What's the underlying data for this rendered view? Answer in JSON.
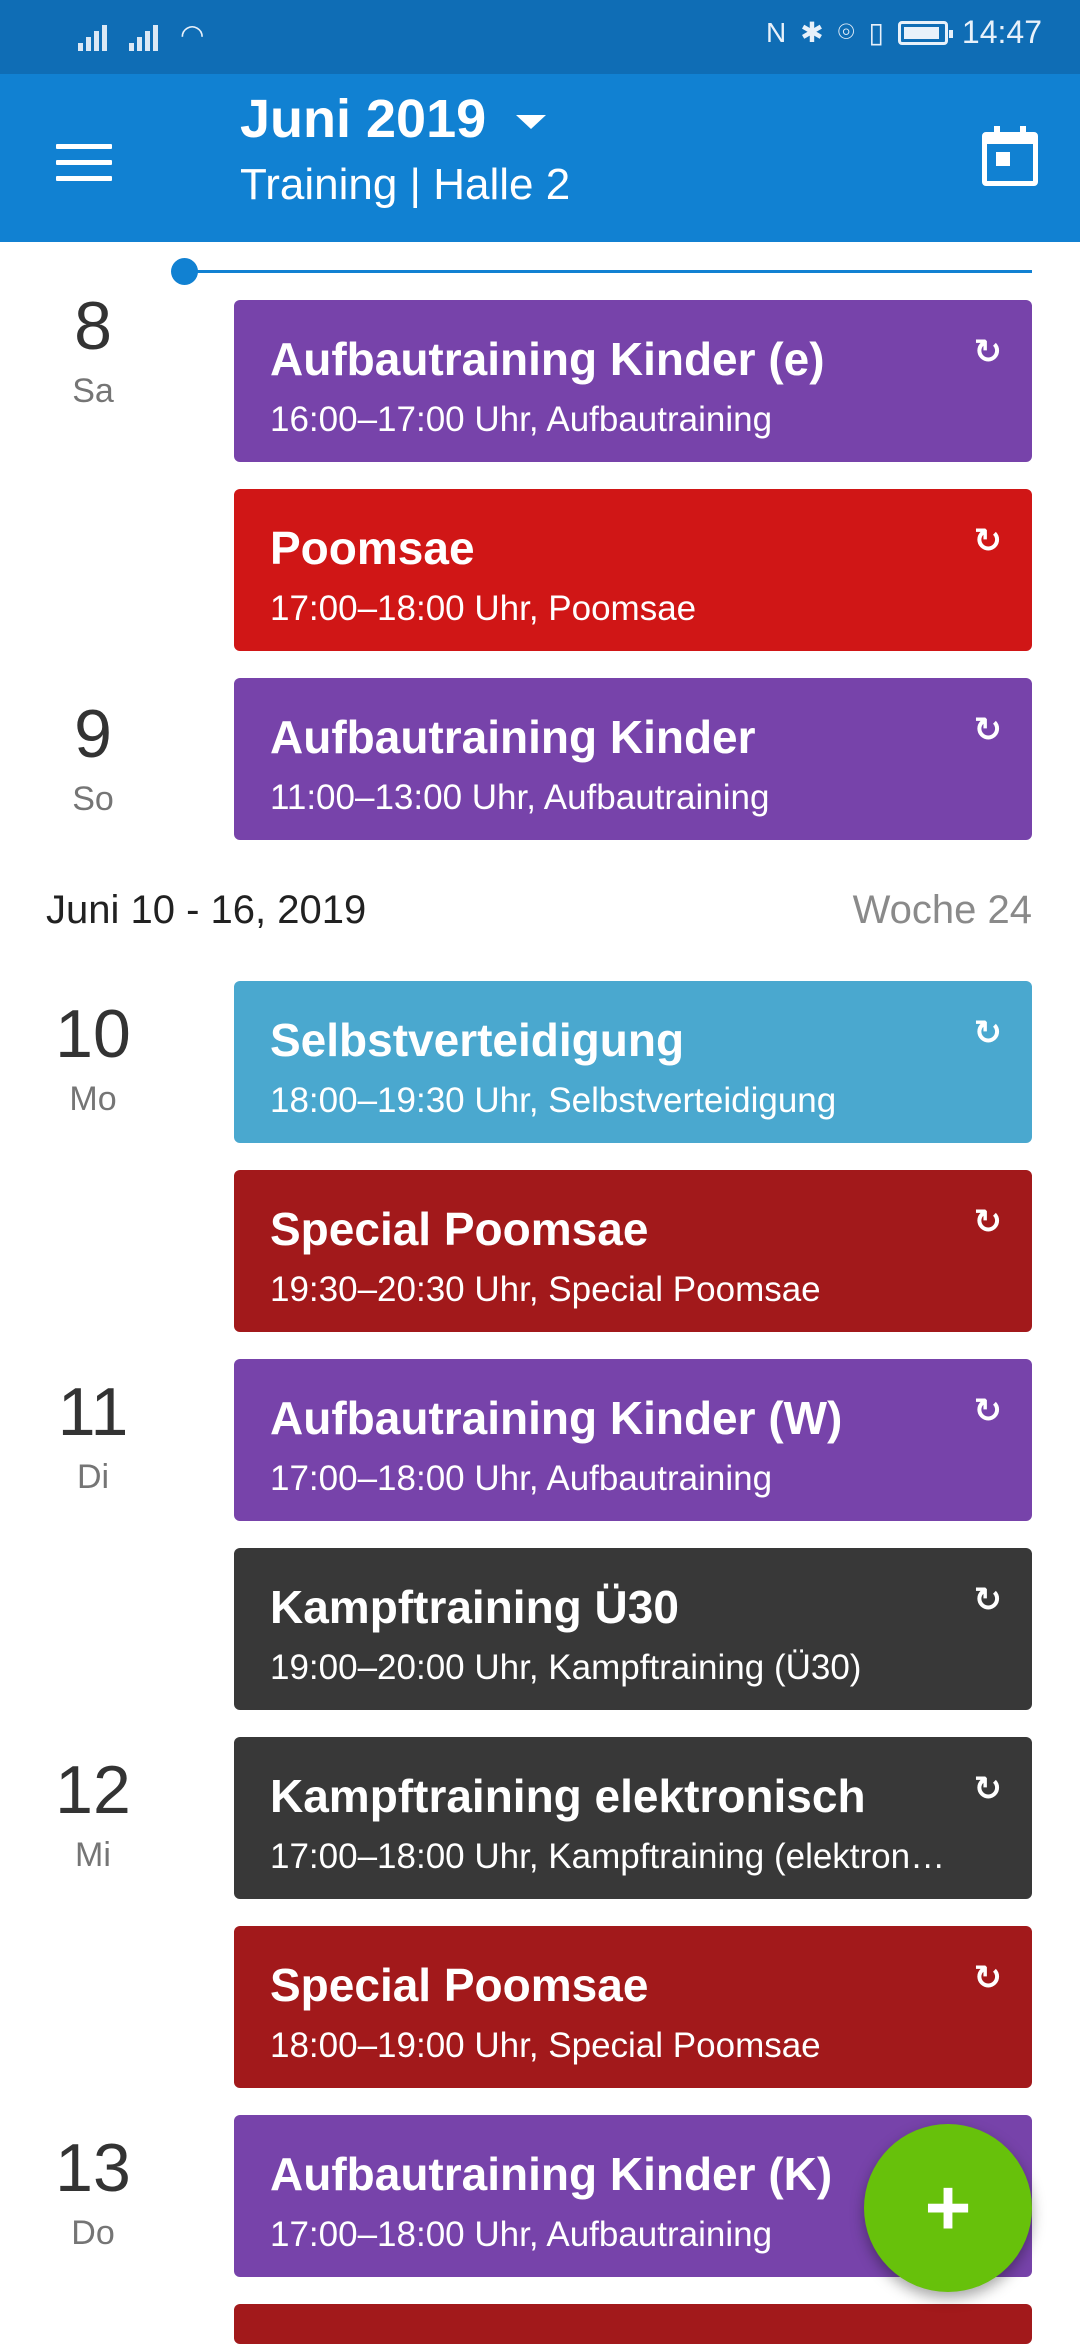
{
  "status_bar": {
    "time": "14:47",
    "icons": [
      "signal-icon",
      "signal-icon",
      "wifi-icon",
      "nfc-icon",
      "bluetooth-icon",
      "location-icon",
      "vibrate-icon",
      "battery-icon"
    ]
  },
  "app_bar": {
    "title": "Juni 2019",
    "subtitle": "Training | Halle 2"
  },
  "days": [
    {
      "num": "8",
      "weekday": "Sa"
    },
    {
      "num": "9",
      "weekday": "So"
    },
    {
      "num": "10",
      "weekday": "Mo"
    },
    {
      "num": "11",
      "weekday": "Di"
    },
    {
      "num": "12",
      "weekday": "Mi"
    },
    {
      "num": "13",
      "weekday": "Do"
    }
  ],
  "week_header": {
    "range": "Juni 10 - 16, 2019",
    "week": "Woche 24"
  },
  "events": [
    {
      "title": "Aufbautraining Kinder (e)",
      "subtitle": "16:00–17:00 Uhr, Aufbautraining",
      "color": "#7743aa"
    },
    {
      "title": "Poomsae",
      "subtitle": "17:00–18:00 Uhr, Poomsae",
      "color": "#d01616"
    },
    {
      "title": "Aufbautraining Kinder",
      "subtitle": "11:00–13:00 Uhr, Aufbautraining",
      "color": "#7743aa"
    },
    {
      "title": "Selbstverteidigung",
      "subtitle": "18:00–19:30 Uhr, Selbstverteidigung",
      "color": "#4aa8cf"
    },
    {
      "title": "Special Poomsae",
      "subtitle": "19:30–20:30 Uhr, Special Poomsae",
      "color": "#a2191b"
    },
    {
      "title": "Aufbautraining Kinder (W)",
      "subtitle": "17:00–18:00 Uhr, Aufbautraining",
      "color": "#7743aa"
    },
    {
      "title": "Kampftraining Ü30",
      "subtitle": "19:00–20:00 Uhr, Kampftraining (Ü30)",
      "color": "#383838"
    },
    {
      "title": "Kampftraining elektronisch",
      "subtitle": "17:00–18:00 Uhr, Kampftraining (elektron…",
      "color": "#383838"
    },
    {
      "title": "Special Poomsae",
      "subtitle": "18:00–19:00 Uhr, Special Poomsae",
      "color": "#a2191b"
    },
    {
      "title": "Aufbautraining Kinder (K)",
      "subtitle": "17:00–18:00 Uhr, Aufbautraining",
      "color": "#7743aa"
    }
  ],
  "repeat_icon": "↻",
  "fab": {
    "icon": "+"
  },
  "colors": {
    "primary": "#1181d2",
    "status_bar": "#0f6db5",
    "fab": "#67c10b"
  }
}
